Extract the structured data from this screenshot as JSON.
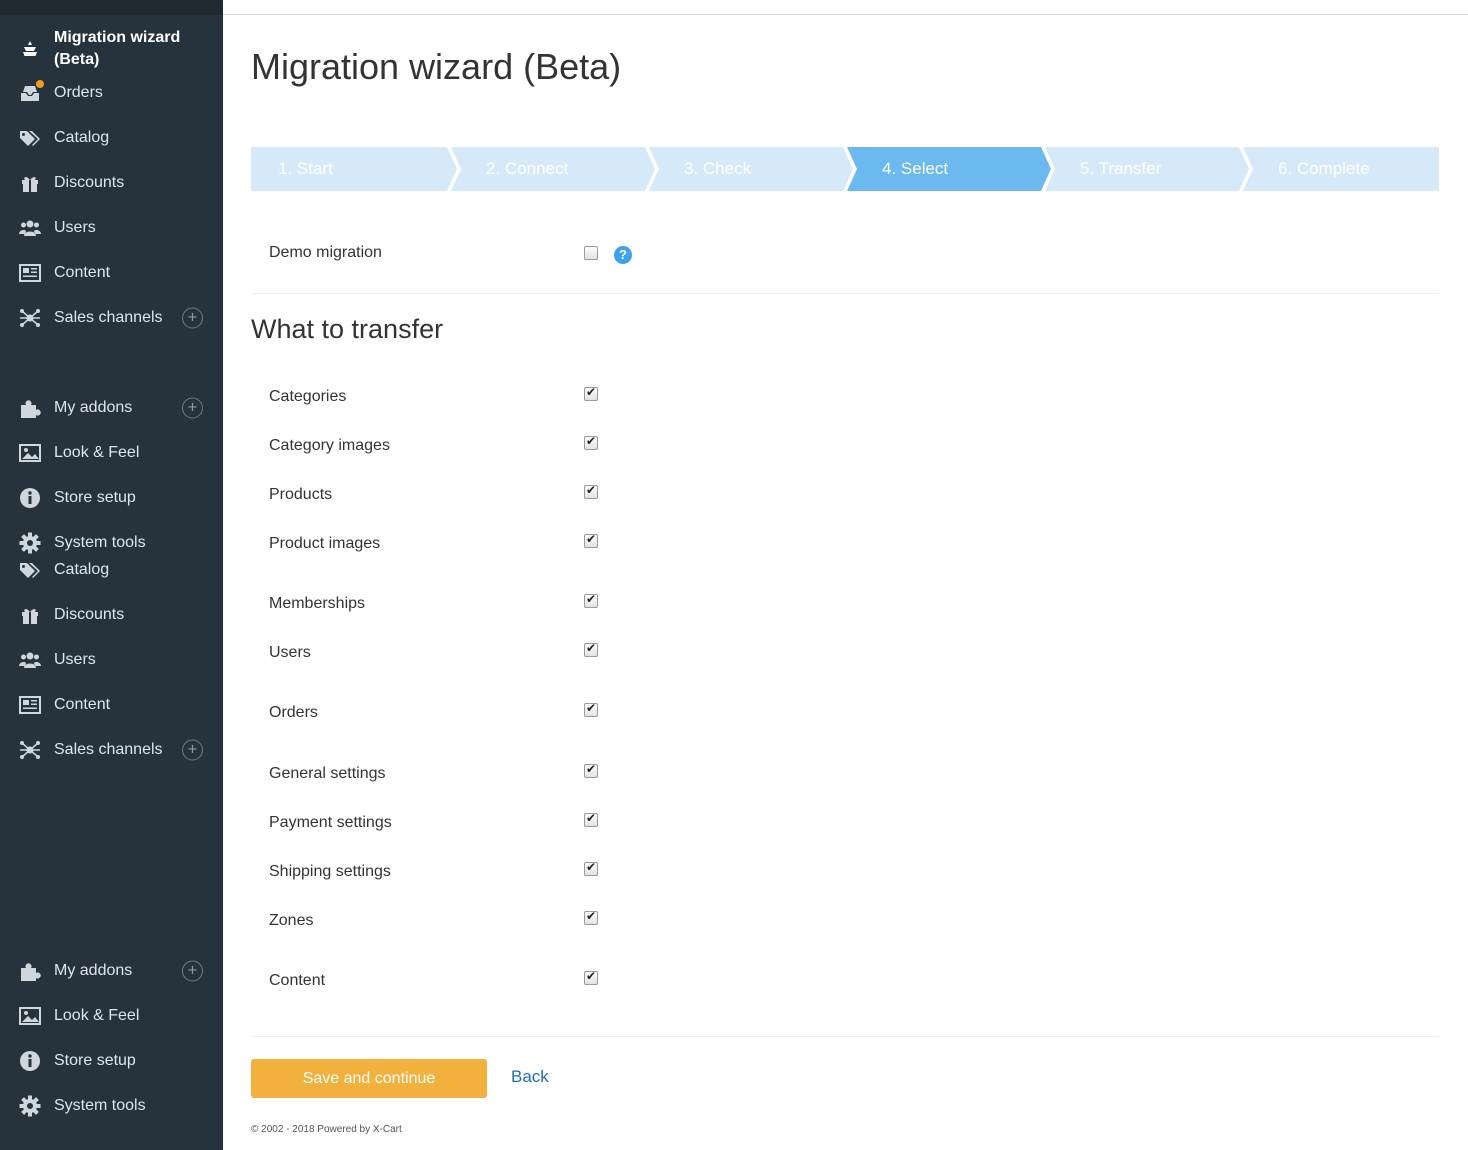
{
  "sidebar": {
    "active": {
      "label": "Migration wizard (Beta)",
      "icon": "migration-icon"
    },
    "items": [
      {
        "label": "Orders",
        "icon": "orders-icon",
        "name": "sidebar-item-orders"
      },
      {
        "label": "Catalog",
        "icon": "tags-icon",
        "name": "sidebar-item-catalog"
      },
      {
        "label": "Discounts",
        "icon": "gift-icon",
        "name": "sidebar-item-discounts"
      },
      {
        "label": "Users",
        "icon": "users-icon",
        "name": "sidebar-item-users"
      },
      {
        "label": "Content",
        "icon": "content-icon",
        "name": "sidebar-item-content"
      },
      {
        "label": "Sales channels",
        "icon": "network-icon",
        "name": "sidebar-item-sales-channels",
        "plus": true
      },
      {
        "label": "My addons",
        "icon": "puzzle-icon",
        "name": "sidebar-item-my-addons",
        "plus": true
      },
      {
        "label": "Look & Feel",
        "icon": "image-icon",
        "name": "sidebar-item-look-feel"
      },
      {
        "label": "Store setup",
        "icon": "info-icon",
        "name": "sidebar-item-store-setup"
      },
      {
        "label": "System tools",
        "icon": "gear-icon",
        "name": "sidebar-item-system-tools"
      },
      {
        "label": "Catalog",
        "icon": "tags-icon",
        "name": "sidebar-item-catalog-dup"
      },
      {
        "label": "Discounts",
        "icon": "gift-icon",
        "name": "sidebar-item-discounts-dup"
      },
      {
        "label": "Users",
        "icon": "users-icon",
        "name": "sidebar-item-users-dup"
      },
      {
        "label": "Content",
        "icon": "content-icon",
        "name": "sidebar-item-content-dup"
      },
      {
        "label": "Sales channels",
        "icon": "network-icon",
        "name": "sidebar-item-sales-channels-dup",
        "plus": true
      },
      {
        "label": "My addons",
        "icon": "puzzle-icon",
        "name": "sidebar-item-my-addons-dup",
        "plus": true
      },
      {
        "label": "Look & Feel",
        "icon": "image-icon",
        "name": "sidebar-item-look-feel-dup"
      },
      {
        "label": "Store setup",
        "icon": "info-icon",
        "name": "sidebar-item-store-setup-dup"
      },
      {
        "label": "System tools",
        "icon": "gear-icon",
        "name": "sidebar-item-system-tools-dup"
      }
    ],
    "plus_symbol": "+",
    "orders_badge_color": "#f39c1f"
  },
  "page": {
    "title": "Migration wizard (Beta)"
  },
  "steps": [
    {
      "label": "1. Start",
      "active": false
    },
    {
      "label": "2. Connect",
      "active": false
    },
    {
      "label": "3. Check",
      "active": false
    },
    {
      "label": "4. Select",
      "active": true
    },
    {
      "label": "5. Transfer",
      "active": false
    },
    {
      "label": "6. Complete",
      "active": false
    }
  ],
  "step_colors": {
    "inactive": "#d6e9f8",
    "active": "#6cb9ef"
  },
  "demo": {
    "label": "Demo migration",
    "checked": false,
    "help": "?"
  },
  "transfer": {
    "title": "What to transfer",
    "options": [
      {
        "label": "Categories",
        "checked": true
      },
      {
        "label": "Category images",
        "checked": true
      },
      {
        "label": "Products",
        "checked": true
      },
      {
        "label": "Product images",
        "checked": true
      },
      {
        "label": "Memberships",
        "checked": true
      },
      {
        "label": "Users",
        "checked": true
      },
      {
        "label": "Orders",
        "checked": true
      },
      {
        "label": "General settings",
        "checked": true
      },
      {
        "label": "Payment settings",
        "checked": true
      },
      {
        "label": "Shipping settings",
        "checked": true
      },
      {
        "label": "Zones",
        "checked": true
      },
      {
        "label": "Content",
        "checked": true
      }
    ]
  },
  "actions": {
    "save": "Save and continue",
    "back": "Back"
  },
  "footer": "© 2002 - 2018 Powered by X-Cart",
  "colors": {
    "sidebar_bg": "#26333d",
    "save_button": "#f2b03d",
    "link": "#1d6fb4"
  }
}
